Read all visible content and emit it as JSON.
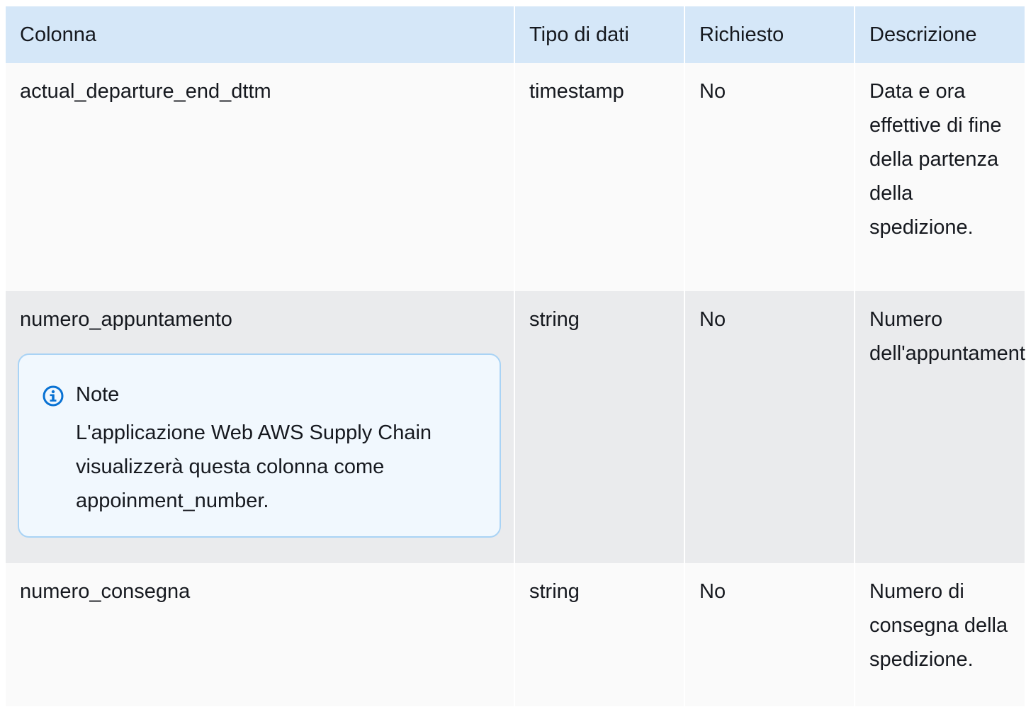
{
  "table": {
    "headers": [
      "Colonna",
      "Tipo di dati",
      "Richiesto",
      "Descrizione"
    ],
    "rows": [
      {
        "column": "actual_departure_end_dttm",
        "type": "timestamp",
        "required": "No",
        "description": "Data e ora effettive di fine della partenza della spedizione."
      },
      {
        "column": "numero_appuntamento",
        "type": "string",
        "required": "No",
        "description": "Numero dell'appuntamento.",
        "note": {
          "title": "Note",
          "text": "L'applicazione Web AWS Supply Chain visualizzerà questa colonna come appoinment_number."
        }
      },
      {
        "column": "numero_consegna",
        "type": "string",
        "required": "No",
        "description": "Numero di consegna della spedizione."
      }
    ]
  },
  "colors": {
    "header_bg": "#d5e7f8",
    "row_light": "#fafafa",
    "row_dark": "#eaebed",
    "note_bg": "#f1f8fe",
    "note_border": "#a9d3f5",
    "info_icon": "#0972d3"
  },
  "icons": {
    "note": "info-circle-icon"
  }
}
